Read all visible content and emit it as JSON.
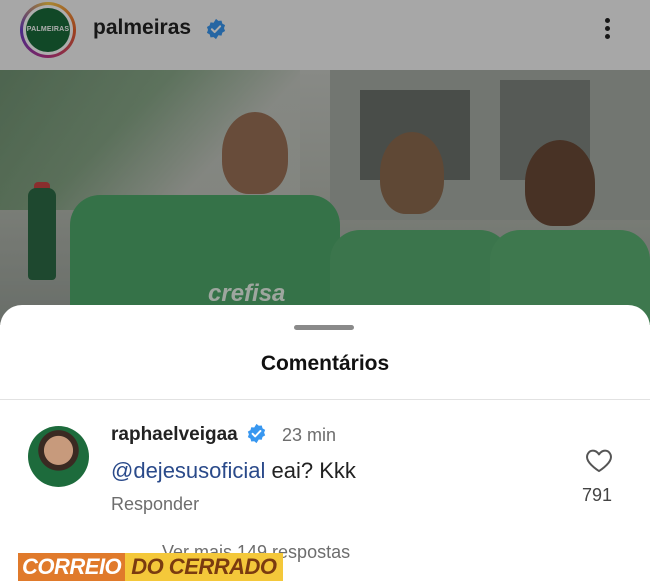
{
  "post": {
    "account_name": "palmeiras",
    "avatar_logo_text": "PALMEIRAS",
    "sponsor_text": "crefisa"
  },
  "sheet": {
    "title": "Comentários"
  },
  "comment": {
    "username": "raphaelveigaa",
    "time": "23 min",
    "mention": "@dejesusoficial",
    "text": " eai? Kkk",
    "reply_label": "Responder",
    "likes": "791",
    "more_replies": "Ver mais 149 respostas"
  },
  "watermark": {
    "part1": "CORREIO",
    "part2": "DO CERRADO"
  },
  "colors": {
    "verified_blue": "#3897f0",
    "mention_blue": "#2a4a8a",
    "watermark_orange": "#e07a2b",
    "watermark_yellow": "#f4c83a"
  },
  "icons": [
    "verified-badge-icon",
    "more-options-icon",
    "heart-icon"
  ]
}
